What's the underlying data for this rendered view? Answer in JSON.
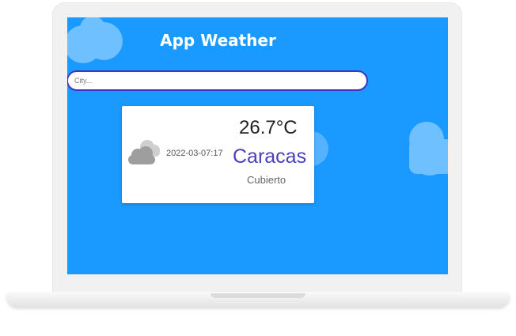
{
  "app": {
    "title": "App Weather"
  },
  "search": {
    "placeholder": "City..."
  },
  "weather": {
    "date": "2022-03-07:17",
    "temperature": "26.7°C",
    "city": "Caracas",
    "description": "Cubierto",
    "icon": "cloudy-icon"
  },
  "colors": {
    "screen_bg": "#1a99ff",
    "title": "#ffffff",
    "city": "#4a3fbf",
    "search_border": "#3a36c4"
  }
}
